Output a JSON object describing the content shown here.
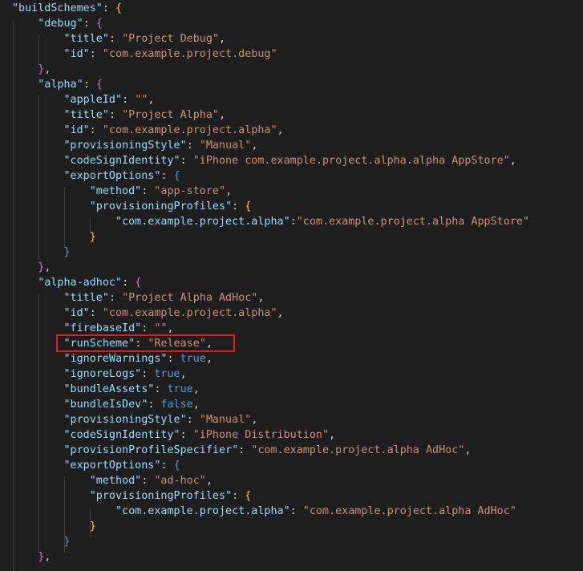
{
  "colors": {
    "background": "#1e1e1e",
    "key": "#9cdcfe",
    "string": "#ce9178",
    "punctuation": "#d4d4d4",
    "boolean": "#569cd6",
    "brace_level1": "#ffd700",
    "brace_level2": "#da70d6",
    "highlight_box": "#e31b23"
  },
  "lines": [
    [
      {
        "t": "\"buildSchemes\"",
        "c": "k"
      },
      {
        "t": ": ",
        "c": "p"
      },
      {
        "t": "{",
        "c": "y"
      }
    ],
    [
      {
        "t": "    "
      },
      {
        "t": "\"debug\"",
        "c": "k"
      },
      {
        "t": ": ",
        "c": "p"
      },
      {
        "t": "{",
        "c": "m"
      }
    ],
    [
      {
        "t": "        "
      },
      {
        "t": "\"title\"",
        "c": "k"
      },
      {
        "t": ": ",
        "c": "p"
      },
      {
        "t": "\"Project Debug\"",
        "c": "s"
      },
      {
        "t": ",",
        "c": "p"
      }
    ],
    [
      {
        "t": "        "
      },
      {
        "t": "\"id\"",
        "c": "k"
      },
      {
        "t": ": ",
        "c": "p"
      },
      {
        "t": "\"com.example.project.debug\"",
        "c": "s"
      }
    ],
    [
      {
        "t": "    "
      },
      {
        "t": "}",
        "c": "m"
      },
      {
        "t": ",",
        "c": "p"
      }
    ],
    [
      {
        "t": "    "
      },
      {
        "t": "\"alpha\"",
        "c": "k"
      },
      {
        "t": ": ",
        "c": "p"
      },
      {
        "t": "{",
        "c": "m"
      }
    ],
    [
      {
        "t": "        "
      },
      {
        "t": "\"appleId\"",
        "c": "k"
      },
      {
        "t": ": ",
        "c": "p"
      },
      {
        "t": "\"\"",
        "c": "s"
      },
      {
        "t": ",",
        "c": "p"
      }
    ],
    [
      {
        "t": "        "
      },
      {
        "t": "\"title\"",
        "c": "k"
      },
      {
        "t": ": ",
        "c": "p"
      },
      {
        "t": "\"Project Alpha\"",
        "c": "s"
      },
      {
        "t": ",",
        "c": "p"
      }
    ],
    [
      {
        "t": "        "
      },
      {
        "t": "\"id\"",
        "c": "k"
      },
      {
        "t": ": ",
        "c": "p"
      },
      {
        "t": "\"com.example.project.alpha\"",
        "c": "s"
      },
      {
        "t": ",",
        "c": "p"
      }
    ],
    [
      {
        "t": "        "
      },
      {
        "t": "\"provisioningStyle\"",
        "c": "k"
      },
      {
        "t": ": ",
        "c": "p"
      },
      {
        "t": "\"Manual\"",
        "c": "s"
      },
      {
        "t": ",",
        "c": "p"
      }
    ],
    [
      {
        "t": "        "
      },
      {
        "t": "\"codeSignIdentity\"",
        "c": "k"
      },
      {
        "t": ": ",
        "c": "p"
      },
      {
        "t": "\"iPhone com.example.project.alpha.alpha AppStore\"",
        "c": "s"
      },
      {
        "t": ",",
        "c": "p"
      }
    ],
    [
      {
        "t": "        "
      },
      {
        "t": "\"exportOptions\"",
        "c": "k"
      },
      {
        "t": ": ",
        "c": "p"
      },
      {
        "t": "{",
        "c": "b"
      }
    ],
    [
      {
        "t": "            "
      },
      {
        "t": "\"method\"",
        "c": "k"
      },
      {
        "t": ": ",
        "c": "p"
      },
      {
        "t": "\"app-store\"",
        "c": "s"
      },
      {
        "t": ",",
        "c": "p"
      }
    ],
    [
      {
        "t": "            "
      },
      {
        "t": "\"provisioningProfiles\"",
        "c": "k"
      },
      {
        "t": ": ",
        "c": "p"
      },
      {
        "t": "{",
        "c": "y"
      }
    ],
    [
      {
        "t": "                "
      },
      {
        "t": "\"com.example.project.alpha\"",
        "c": "k"
      },
      {
        "t": ":",
        "c": "p"
      },
      {
        "t": "\"com.example.project.alpha AppStore\"",
        "c": "s"
      }
    ],
    [
      {
        "t": "            "
      },
      {
        "t": "}",
        "c": "y"
      }
    ],
    [
      {
        "t": "        "
      },
      {
        "t": "}",
        "c": "b"
      }
    ],
    [
      {
        "t": "    "
      },
      {
        "t": "}",
        "c": "m"
      },
      {
        "t": ",",
        "c": "p"
      }
    ],
    [
      {
        "t": "    "
      },
      {
        "t": "\"alpha-adhoc\"",
        "c": "k"
      },
      {
        "t": ": ",
        "c": "p"
      },
      {
        "t": "{",
        "c": "m"
      }
    ],
    [
      {
        "t": "        "
      },
      {
        "t": "\"title\"",
        "c": "k"
      },
      {
        "t": ": ",
        "c": "p"
      },
      {
        "t": "\"Project Alpha AdHoc\"",
        "c": "s"
      },
      {
        "t": ",",
        "c": "p"
      }
    ],
    [
      {
        "t": "        "
      },
      {
        "t": "\"id\"",
        "c": "k"
      },
      {
        "t": ": ",
        "c": "p"
      },
      {
        "t": "\"com.example.project.alpha\"",
        "c": "s"
      },
      {
        "t": ",",
        "c": "p"
      }
    ],
    [
      {
        "t": "        "
      },
      {
        "t": "\"firebaseId\"",
        "c": "k"
      },
      {
        "t": ": ",
        "c": "p"
      },
      {
        "t": "\"\"",
        "c": "s"
      },
      {
        "t": ",",
        "c": "p"
      }
    ],
    [
      {
        "t": "        "
      },
      {
        "t": "\"runScheme\"",
        "c": "k"
      },
      {
        "t": ": ",
        "c": "p"
      },
      {
        "t": "\"Release\"",
        "c": "s"
      },
      {
        "t": ",",
        "c": "p"
      }
    ],
    [
      {
        "t": "        "
      },
      {
        "t": "\"ignoreWarnings\"",
        "c": "k"
      },
      {
        "t": ": ",
        "c": "p"
      },
      {
        "t": "true",
        "c": "b"
      },
      {
        "t": ",",
        "c": "p"
      }
    ],
    [
      {
        "t": "        "
      },
      {
        "t": "\"ignoreLogs\"",
        "c": "k"
      },
      {
        "t": ": ",
        "c": "p"
      },
      {
        "t": "true",
        "c": "b"
      },
      {
        "t": ",",
        "c": "p"
      }
    ],
    [
      {
        "t": "        "
      },
      {
        "t": "\"bundleAssets\"",
        "c": "k"
      },
      {
        "t": ": ",
        "c": "p"
      },
      {
        "t": "true",
        "c": "b"
      },
      {
        "t": ",",
        "c": "p"
      }
    ],
    [
      {
        "t": "        "
      },
      {
        "t": "\"bundleIsDev\"",
        "c": "k"
      },
      {
        "t": ": ",
        "c": "p"
      },
      {
        "t": "false",
        "c": "b"
      },
      {
        "t": ",",
        "c": "p"
      }
    ],
    [
      {
        "t": "        "
      },
      {
        "t": "\"provisioningStyle\"",
        "c": "k"
      },
      {
        "t": ": ",
        "c": "p"
      },
      {
        "t": "\"Manual\"",
        "c": "s"
      },
      {
        "t": ",",
        "c": "p"
      }
    ],
    [
      {
        "t": "        "
      },
      {
        "t": "\"codeSignIdentity\"",
        "c": "k"
      },
      {
        "t": ": ",
        "c": "p"
      },
      {
        "t": "\"iPhone Distribution\"",
        "c": "s"
      },
      {
        "t": ",",
        "c": "p"
      }
    ],
    [
      {
        "t": "        "
      },
      {
        "t": "\"provisionProfileSpecifier\"",
        "c": "k"
      },
      {
        "t": ": ",
        "c": "p"
      },
      {
        "t": "\"com.example.project.alpha AdHoc\"",
        "c": "s"
      },
      {
        "t": ",",
        "c": "p"
      }
    ],
    [
      {
        "t": "        "
      },
      {
        "t": "\"exportOptions\"",
        "c": "k"
      },
      {
        "t": ": ",
        "c": "p"
      },
      {
        "t": "{",
        "c": "b"
      }
    ],
    [
      {
        "t": "            "
      },
      {
        "t": "\"method\"",
        "c": "k"
      },
      {
        "t": ": ",
        "c": "p"
      },
      {
        "t": "\"ad-hoc\"",
        "c": "s"
      },
      {
        "t": ",",
        "c": "p"
      }
    ],
    [
      {
        "t": "            "
      },
      {
        "t": "\"provisioningProfiles\"",
        "c": "k"
      },
      {
        "t": ": ",
        "c": "p"
      },
      {
        "t": "{",
        "c": "y"
      }
    ],
    [
      {
        "t": "                "
      },
      {
        "t": "\"com.example.project.alpha\"",
        "c": "k"
      },
      {
        "t": ": ",
        "c": "p"
      },
      {
        "t": "\"com.example.project.alpha AdHoc\"",
        "c": "s"
      }
    ],
    [
      {
        "t": "            "
      },
      {
        "t": "}",
        "c": "y"
      }
    ],
    [
      {
        "t": "        "
      },
      {
        "t": "}",
        "c": "b"
      }
    ],
    [
      {
        "t": "    "
      },
      {
        "t": "}",
        "c": "m"
      },
      {
        "t": ",",
        "c": "p"
      }
    ]
  ]
}
